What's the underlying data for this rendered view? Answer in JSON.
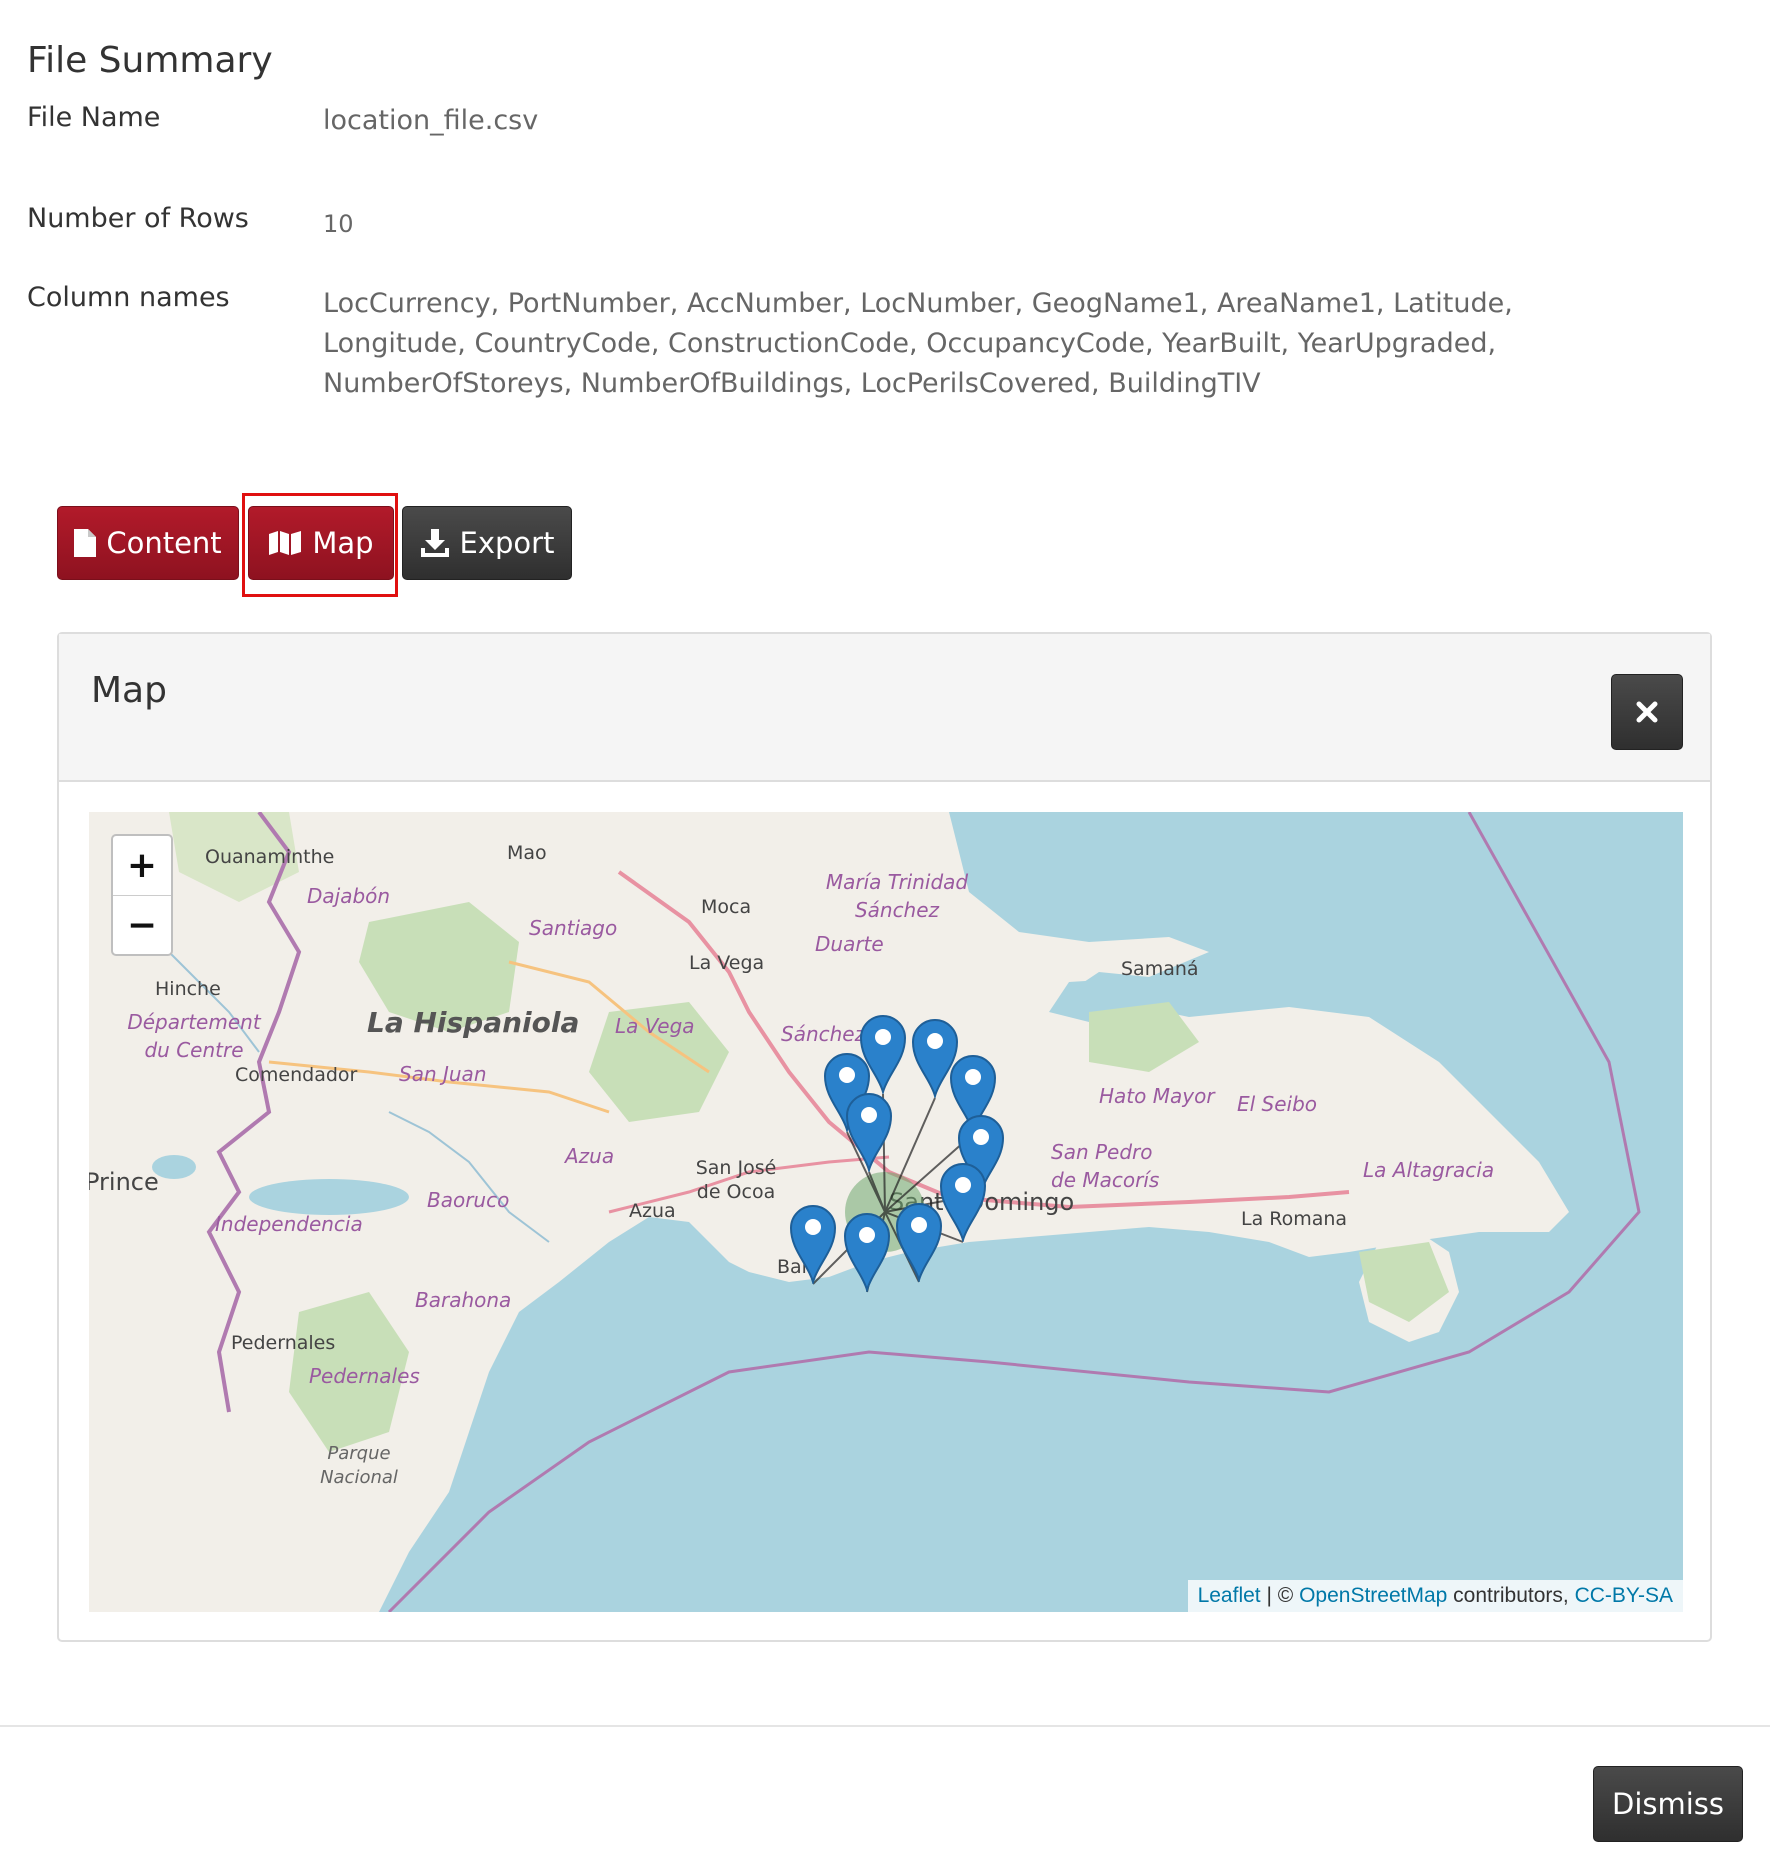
{
  "summary": {
    "title": "File Summary",
    "rows": [
      {
        "label": "File Name",
        "value": "location_file.csv"
      },
      {
        "label": "Number of Rows",
        "value": "10"
      },
      {
        "label": "Column names",
        "value": "LocCurrency, PortNumber, AccNumber, LocNumber, GeogName1, AreaName1, Latitude, Longitude, CountryCode, ConstructionCode, OccupancyCode, YearBuilt, YearUpgraded, NumberOfStoreys, NumberOfBuildings, LocPerilsCovered, BuildingTIV"
      }
    ]
  },
  "buttons": {
    "content": "Content",
    "map": "Map",
    "export": "Export",
    "dismiss": "Dismiss"
  },
  "map_panel": {
    "title": "Map",
    "zoom_in": "+",
    "zoom_out": "−",
    "close_icon": "times-icon",
    "attribution": {
      "leaflet": "Leaflet",
      "sep": " | © ",
      "osm": "OpenStreetMap",
      "contributors": " contributors, ",
      "license": "CC-BY-SA"
    },
    "place_labels": [
      "Ouanaminthe",
      "Mao",
      "Dajabón",
      "María Trinidad Sánchez",
      "Moca",
      "Santiago",
      "Duarte",
      "La Vega",
      "Samaná",
      "Hinche",
      "Département du Centre",
      "La Hispaniola",
      "La Vega",
      "Sánchez",
      "Comendador",
      "San Juan",
      "Hato Mayor",
      "El Seibo",
      "Azua",
      "San José de Ocoa",
      "San Pedro de Macorís",
      "La Altagracia",
      "Prince",
      "Baoruco",
      "Azua",
      "Independencia",
      "La Romana",
      "Baní",
      "Barahona",
      "Pedernales",
      "Pedernales",
      "Parque Nacional",
      "Santo Domingo"
    ],
    "marker_count": 10
  },
  "colors": {
    "primary_red": "#9e1726",
    "dark_button": "#3a3a3a",
    "sea": "#aad3df",
    "land": "#f2efe9",
    "marker": "#2a81cb"
  }
}
